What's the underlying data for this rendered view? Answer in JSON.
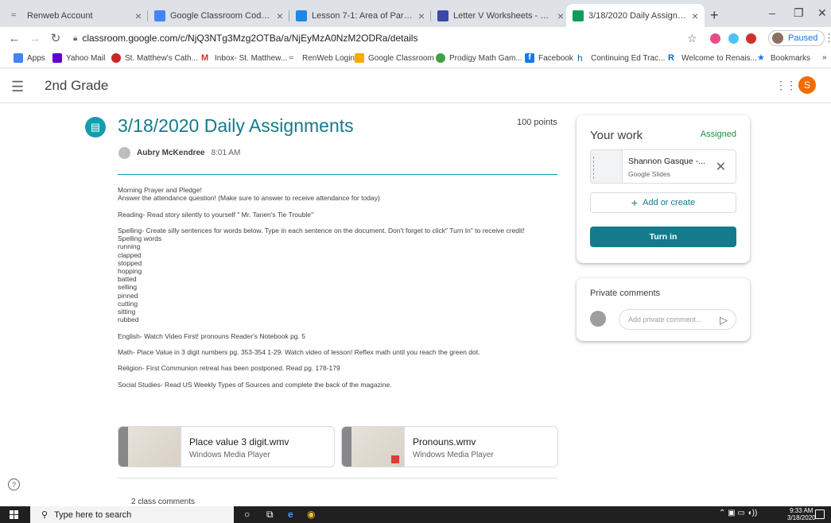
{
  "browser": {
    "tabs": [
      {
        "title": "Renweb Account",
        "color": "#5f6368",
        "active": false
      },
      {
        "title": "Google Classroom Codes - Goog",
        "color": "#4285f4",
        "active": false
      },
      {
        "title": "Lesson 7-1: Area of Parallelogram",
        "color": "#1e88e5",
        "active": false
      },
      {
        "title": "Letter V Worksheets - Recognize",
        "color": "#3949ab",
        "active": false
      },
      {
        "title": "3/18/2020 Daily Assignments",
        "color": "#0f9d58",
        "active": true
      }
    ],
    "url": "classroom.google.com/c/NjQ3NTg3Mzg2OTBa/a/NjEyMzA0NzM2ODRa/details",
    "profile_status": "Paused",
    "bookmarks": [
      "Apps",
      "Yahoo Mail",
      "St. Matthew's Cath...",
      "Inbox- St. Matthew...",
      "RenWeb Login",
      "Google Classroom",
      "Prodigy Math Gam...",
      "Facebook",
      "Continuing Ed Trac...",
      "Welcome to Renais...",
      "Bookmarks"
    ]
  },
  "classroom": {
    "class_name": "2nd Grade",
    "user_initial": "S"
  },
  "assignment": {
    "title": "3/18/2020 Daily Assignments",
    "points": "100 points",
    "author": "Aubry McKendree",
    "time": "8:01 AM",
    "body": "Morning Prayer and Pledge!\nAnswer the attendance question! (Make sure to answer to receive attendance for today)\n\nReading- Read story silently to yourself \" Mr. Tanen's Tie Trouble\"\n\nSpelling- Create silly sentences for words below. Type in each sentence on the document. Don't forget to click\" Turn In\" to receive credit!\nSpelling words\nrunning\nclapped\nstopped\nhopping\nbatted\nselling\npinned\ncutting\nsitting\nrubbed\n\nEnglish- Watch Video First! pronouns Reader's Notebook pg. 5\n\nMath- Place Value in 3 digit numbers pg. 353-354 1-29. Watch video of lesson! Reflex math until you reach the green dot.\n\nReligion- First Communion retreat has been postponed. Read pg. 178-179\n\nSocial Studies- Read US Weekly Types of Sources and complete the back of the magazine.",
    "attachments": [
      {
        "name": "Place value 3 digit.wmv",
        "type": "Windows Media Player"
      },
      {
        "name": "Pronouns.wmv",
        "type": "Windows Media Player"
      }
    ],
    "class_comments": "2 class comments"
  },
  "your_work": {
    "title": "Your work",
    "status": "Assigned",
    "file_name": "Shannon Gasque -...",
    "file_type": "Google Slides",
    "add_label": "Add or create",
    "turn_in_label": "Turn in"
  },
  "private_comments": {
    "title": "Private comments",
    "placeholder": "Add private comment..."
  },
  "taskbar": {
    "search_placeholder": "Type here to search",
    "time": "9:33 AM",
    "date": "3/18/2020"
  },
  "colors": {
    "accent": "#137b8b",
    "assigned": "#1e8e3e",
    "avatar": "#ef6c00"
  }
}
